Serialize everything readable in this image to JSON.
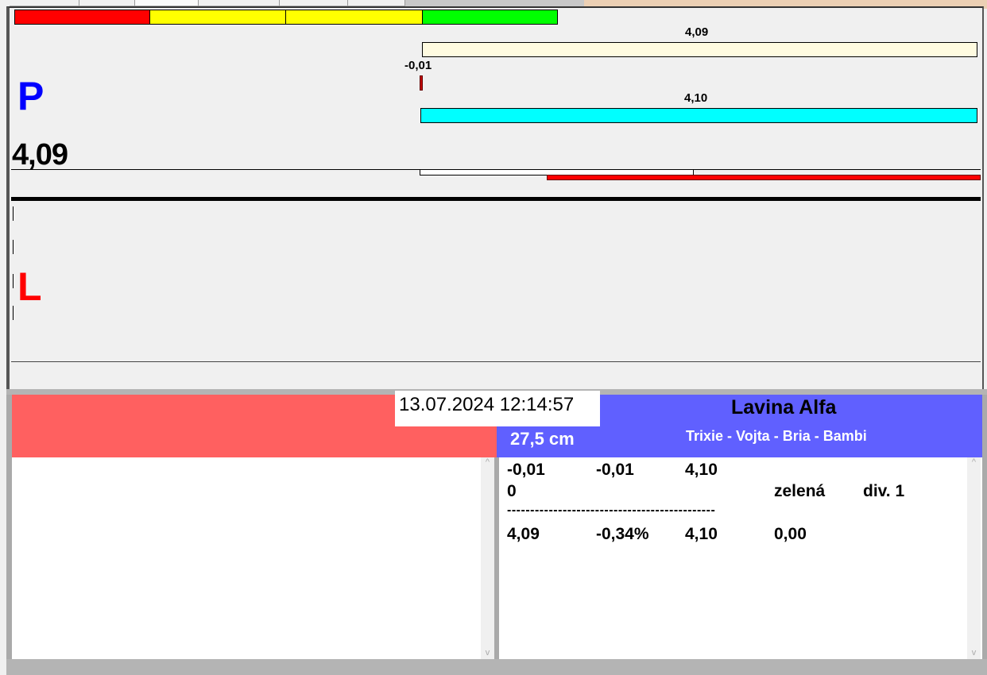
{
  "top_panel": {
    "color_scale": [
      {
        "color": "#ff0000"
      },
      {
        "color": "#ffff00"
      },
      {
        "color": "#ffff00"
      },
      {
        "color": "#00ff00"
      }
    ],
    "bar1": {
      "label": "4,09",
      "value": 4.09,
      "color": "#fffbe0"
    },
    "bar2": {
      "label": "-0,01",
      "value": -0.01,
      "color": "#c00000"
    },
    "bar3": {
      "label": "4,10",
      "value": 4.1,
      "color": "#00ffff"
    },
    "p_label": "P",
    "big_value": "4,09",
    "l_label": "L"
  },
  "bottom": {
    "datetime": "13.07.2024 12:14:57",
    "title": "Lavina Alfa",
    "distance": "27,5 cm",
    "names": "Trixie - Vojta - Bria - Bambi",
    "rows": [
      [
        "-0,01",
        "-0,01",
        "4,10",
        "",
        ""
      ],
      [
        "0",
        "",
        "",
        "zelená",
        "div. 1"
      ],
      [
        "4,09",
        "-0,34%",
        "4,10",
        "0,00",
        ""
      ]
    ],
    "separator": "---------------------------------------------"
  }
}
